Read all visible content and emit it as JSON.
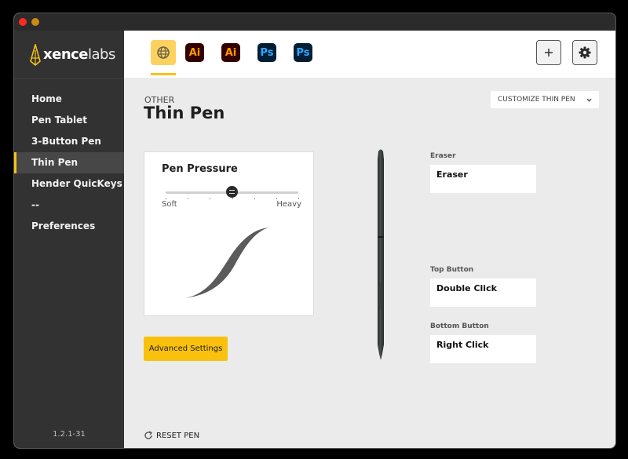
{
  "window": {
    "traffic_lights": [
      "close",
      "minimize"
    ]
  },
  "brand": {
    "logo_bold": "xence",
    "logo_light": "labs",
    "accent_color": "#f6c21a"
  },
  "sidebar": {
    "items": [
      {
        "label": "Home",
        "active": false
      },
      {
        "label": "Pen Tablet",
        "active": false
      },
      {
        "label": "3-Button Pen",
        "active": false
      },
      {
        "label": "Thin Pen",
        "active": true
      },
      {
        "label": "Hender QuicKeys",
        "active": false
      },
      {
        "label": "--",
        "active": false
      },
      {
        "label": "Preferences",
        "active": false
      }
    ],
    "version": "1.2.1-31"
  },
  "toolbar": {
    "app_tabs": [
      {
        "name": "global",
        "icon": "globe-icon",
        "label": "",
        "selected": true
      },
      {
        "name": "illustrator-1",
        "icon": "illustrator-icon",
        "label": "Ai",
        "selected": false
      },
      {
        "name": "illustrator-2",
        "icon": "illustrator-icon",
        "label": "Ai",
        "selected": false
      },
      {
        "name": "photoshop-1",
        "icon": "photoshop-icon",
        "label": "Ps",
        "selected": false
      },
      {
        "name": "photoshop-2",
        "icon": "photoshop-icon",
        "label": "Ps",
        "selected": false
      }
    ],
    "add_icon": "plus-icon",
    "settings_icon": "gear-icon"
  },
  "main": {
    "category": "OTHER",
    "title": "Thin Pen",
    "customize_label": "CUSTOMIZE THIN PEN",
    "pressure": {
      "title": "Pen Pressure",
      "min_label": "Soft",
      "max_label": "Heavy",
      "value_fraction": 0.5,
      "steps": 7
    },
    "advanced_label": "Advanced Settings",
    "buttons": [
      {
        "label": "Eraser",
        "value": "Eraser"
      },
      {
        "label": "Top Button",
        "value": "Double Click"
      },
      {
        "label": "Bottom Button",
        "value": "Right Click"
      }
    ],
    "reset_label": "RESET PEN"
  }
}
